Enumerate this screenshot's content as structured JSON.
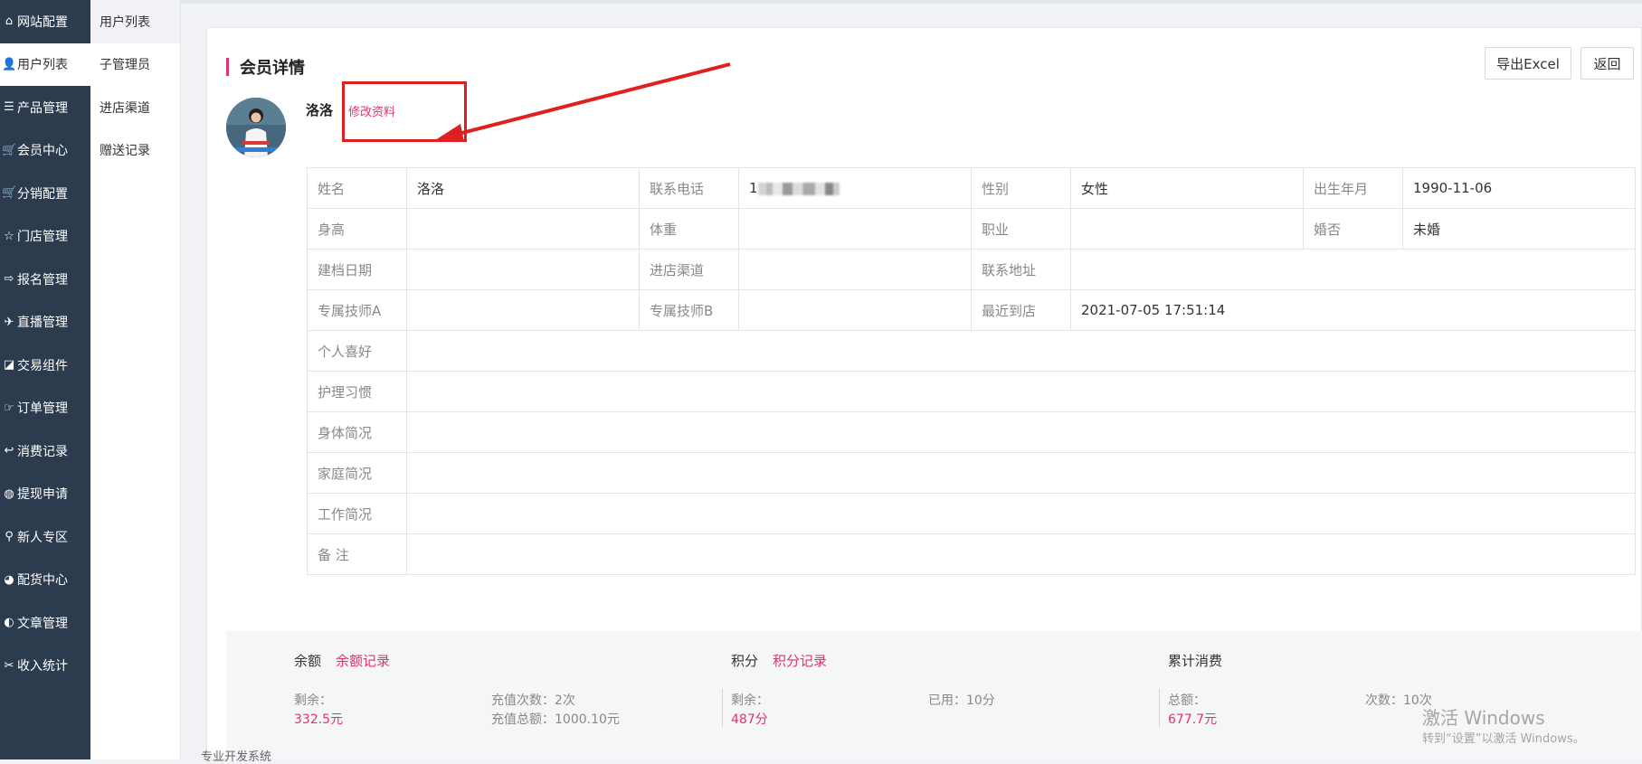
{
  "sidebar": {
    "items": [
      {
        "label": "网站配置",
        "icon": "home-icon",
        "glyph": "⌂"
      },
      {
        "label": "用户列表",
        "icon": "user-icon",
        "glyph": "👤"
      },
      {
        "label": "产品管理",
        "icon": "list-icon",
        "glyph": "☰"
      },
      {
        "label": "会员中心",
        "icon": "cart-icon",
        "glyph": "🛒"
      },
      {
        "label": "分销配置",
        "icon": "cart-icon",
        "glyph": "🛒"
      },
      {
        "label": "门店管理",
        "icon": "star-icon",
        "glyph": "☆"
      },
      {
        "label": "报名管理",
        "icon": "signin-icon",
        "glyph": "⇨"
      },
      {
        "label": "直播管理",
        "icon": "plane-icon",
        "glyph": "✈"
      },
      {
        "label": "交易组件",
        "icon": "eraser-icon",
        "glyph": "◪"
      },
      {
        "label": "订单管理",
        "icon": "hand-icon",
        "glyph": "☞"
      },
      {
        "label": "消费记录",
        "icon": "reply-icon",
        "glyph": "↩"
      },
      {
        "label": "提现申请",
        "icon": "wechat-icon",
        "glyph": "◍"
      },
      {
        "label": "新人专区",
        "icon": "map-pin-icon",
        "glyph": "⚲"
      },
      {
        "label": "配货中心",
        "icon": "pie-chart-icon",
        "glyph": "◕"
      },
      {
        "label": "文章管理",
        "icon": "adjust-icon",
        "glyph": "◐"
      },
      {
        "label": "收入统计",
        "icon": "wrench-icon",
        "glyph": "✂"
      }
    ],
    "active_index": 1
  },
  "subnav": {
    "items": [
      "用户列表",
      "子管理员",
      "进店渠道",
      "赠送记录"
    ],
    "active_index": 0
  },
  "page": {
    "title": "会员详情",
    "export_button": "导出Excel",
    "back_button": "返回",
    "member_name": "洛洛",
    "edit_link": "修改资料"
  },
  "info": {
    "name_label": "姓名",
    "name_value": "洛洛",
    "phone_label": "联系电话",
    "phone_prefix": "1",
    "gender_label": "性别",
    "gender_value": "女性",
    "birth_label": "出生年月",
    "birth_value": "1990-11-06",
    "height_label": "身高",
    "height_value": "",
    "weight_label": "体重",
    "weight_value": "",
    "job_label": "职业",
    "job_value": "",
    "marital_label": "婚否",
    "marital_value": "未婚",
    "file_date_label": "建档日期",
    "file_date_value": "",
    "channel_label": "进店渠道",
    "channel_value": "",
    "address_label": "联系地址",
    "address_value": "",
    "tech_a_label": "专属技师A",
    "tech_a_value": "",
    "tech_b_label": "专属技师B",
    "tech_b_value": "",
    "last_visit_label": "最近到店",
    "last_visit_value": "2021-07-05 17:51:14",
    "hobby_label": "个人喜好",
    "hobby_value": "",
    "care_label": "护理习惯",
    "care_value": "",
    "body_label": "身体简况",
    "body_value": "",
    "family_label": "家庭简况",
    "family_value": "",
    "work_label": "工作简况",
    "work_value": "",
    "note_label": "备 注",
    "note_value": ""
  },
  "stats": {
    "balance": {
      "title": "余额",
      "link": "余额记录",
      "remain_label": "剩余：",
      "remain_value": "332.5元",
      "count_label": "充值次数：2次",
      "total_label": "充值总额：1000.10元"
    },
    "points": {
      "title": "积分",
      "link": "积分记录",
      "remain_label": "剩余：",
      "remain_value": "487分",
      "used_label": "已用：10分"
    },
    "spending": {
      "title": "累计消费",
      "total_label": "总额：",
      "total_value": "677.7元",
      "count_label": "次数：10次"
    }
  },
  "footer": {
    "text": "专业开发系统"
  },
  "watermark": {
    "line1": "激活 Windows",
    "line2": "转到“设置”以激活 Windows。"
  },
  "colors": {
    "sidebar_bg": "#2c3b4e",
    "accent": "#e0336d",
    "annotation_red": "#e02020"
  }
}
